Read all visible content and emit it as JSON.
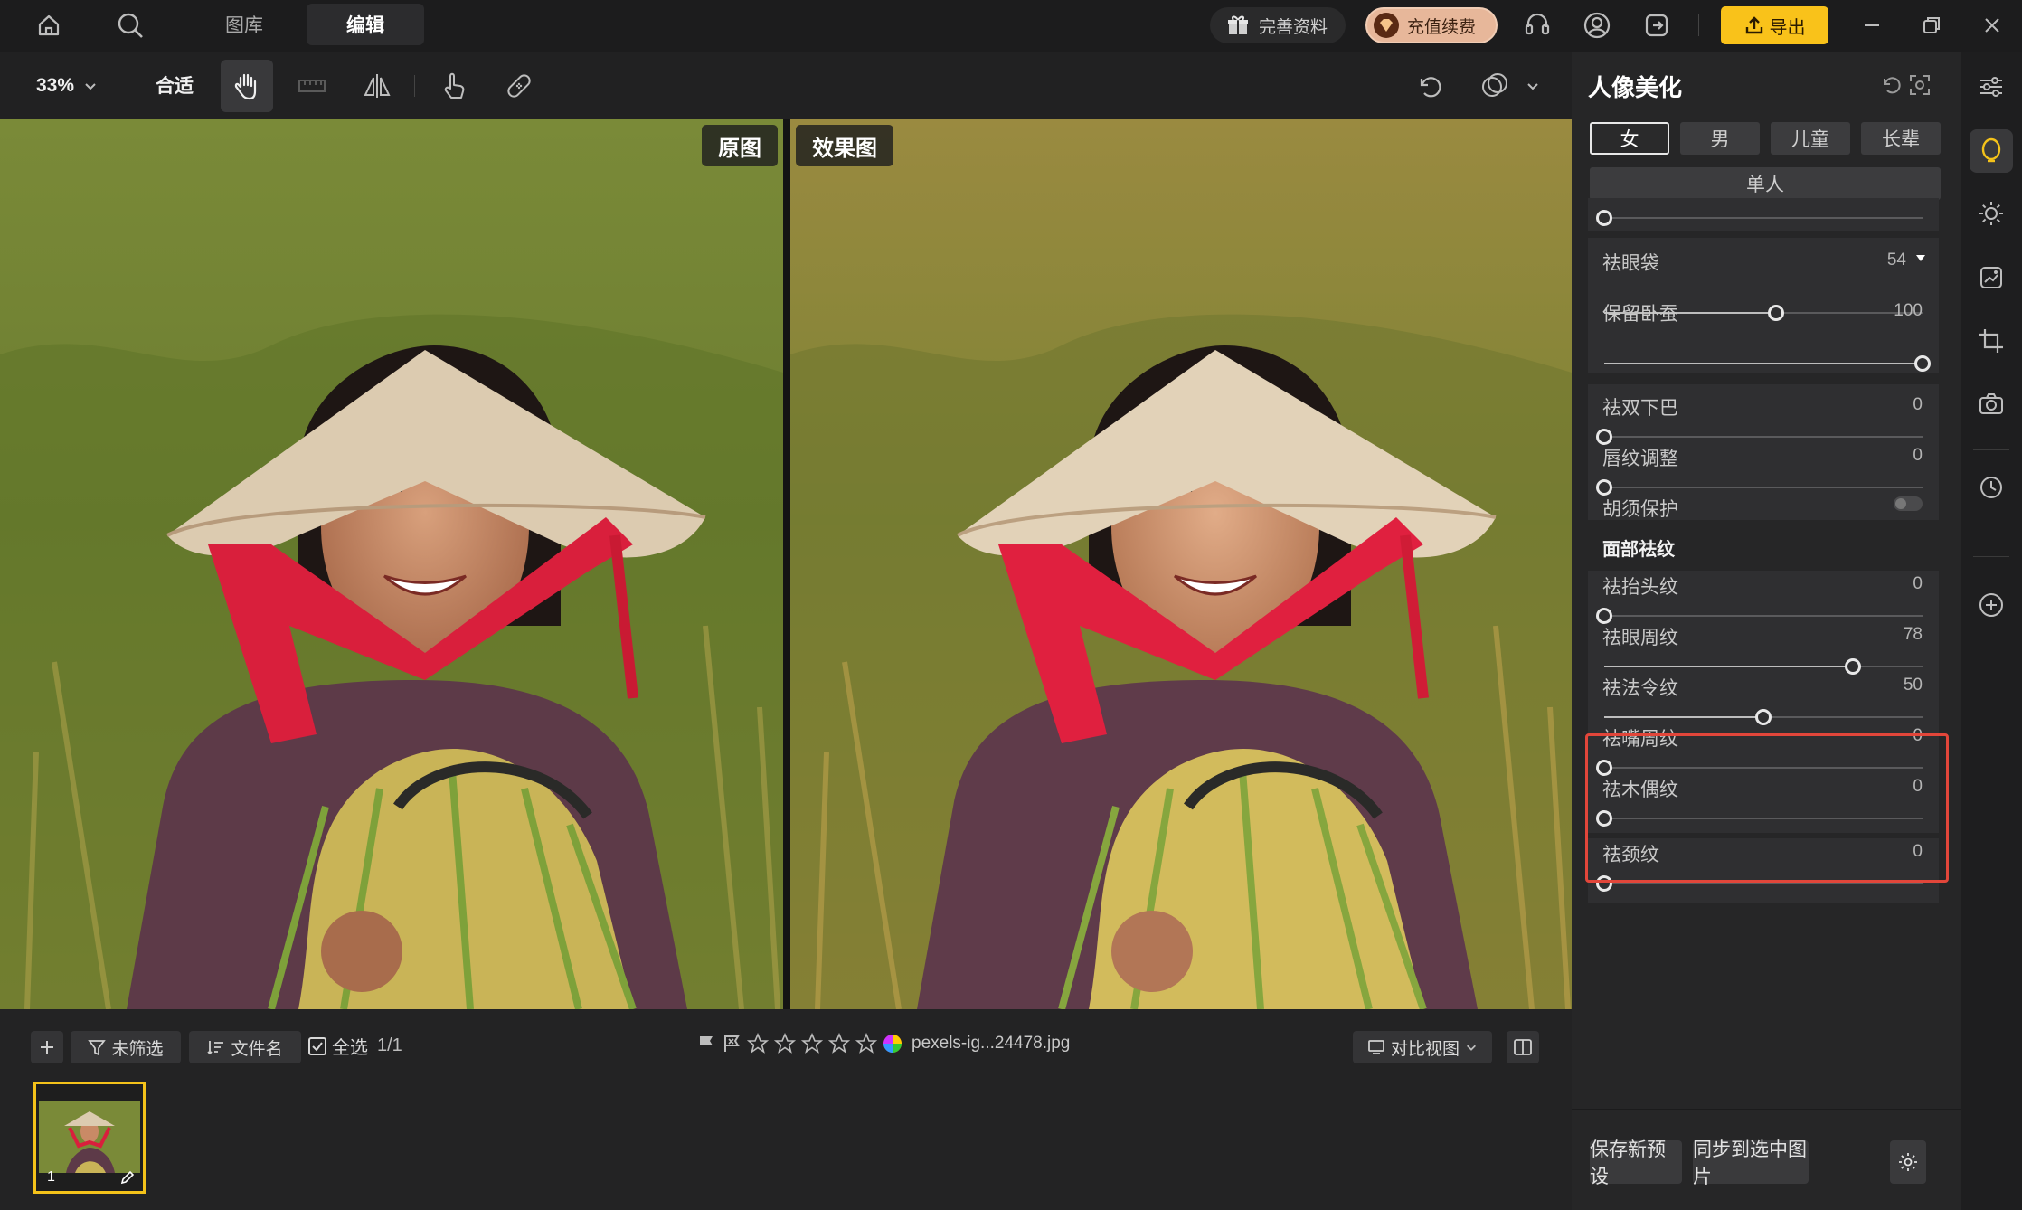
{
  "topbar": {
    "tabs": [
      {
        "label": "图库"
      },
      {
        "label": "编辑"
      }
    ],
    "complete_profile": "完善资料",
    "vip_recharge": "充值续费",
    "export": "导出"
  },
  "toolbar": {
    "zoom": "33%",
    "fit": "合适"
  },
  "compare": {
    "original_label": "原图",
    "effect_label": "效果图"
  },
  "bottom": {
    "filter": "未筛选",
    "sort": "文件名",
    "select_all": "全选",
    "selection_count": "1/1",
    "filename": "pexels-ig...24478.jpg",
    "view_mode": "对比视图",
    "thumb_index": "1"
  },
  "panel": {
    "title": "人像美化",
    "gender_tabs": [
      {
        "label": "女"
      },
      {
        "label": "男"
      },
      {
        "label": "儿童"
      },
      {
        "label": "长辈"
      }
    ],
    "single": "单人",
    "eye_bag": {
      "label": "祛眼袋",
      "value": "54"
    },
    "keep_silkworm": {
      "label": "保留卧蚕",
      "value": "100"
    },
    "double_chin": {
      "label": "祛双下巴",
      "value": "0"
    },
    "lip_lines": {
      "label": "唇纹调整",
      "value": "0"
    },
    "beard_protect": {
      "label": "胡须保护",
      "on": false
    },
    "section_face_lines": "面部祛纹",
    "forehead_lines": {
      "label": "祛抬头纹",
      "value": "0"
    },
    "eye_lines": {
      "label": "祛眼周纹",
      "value": "78"
    },
    "nasolabial": {
      "label": "祛法令纹",
      "value": "50"
    },
    "mouth_lines": {
      "label": "祛嘴周纹",
      "value": "0"
    },
    "marionette": {
      "label": "祛木偶纹",
      "value": "0"
    },
    "neck_lines": {
      "label": "祛颈纹",
      "value": "0"
    },
    "save_preset": "保存新预设",
    "sync_selected": "同步到选中图片"
  }
}
